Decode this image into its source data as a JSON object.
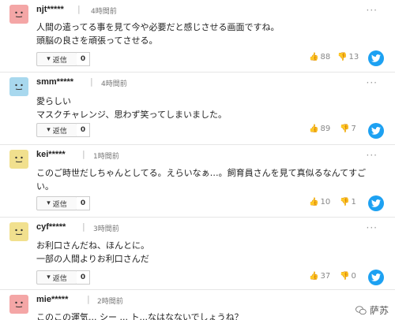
{
  "comments": [
    {
      "user": "njt*****",
      "time": "4時間前",
      "lines": [
        "人間の遣ってる事を見て今や必要だと感じさせる画面ですね。",
        "頭脳の良さを頑張ってさせる。"
      ],
      "reply_label": "返信",
      "reply_count": "0",
      "likes": "88",
      "dislikes": "13",
      "avatar_color": "#f4a6a6"
    },
    {
      "user": "smm*****",
      "time": "4時間前",
      "lines": [
        "愛らしい",
        "マスクチャレンジ、思わず笑ってしまいました。"
      ],
      "reply_label": "返信",
      "reply_count": "0",
      "likes": "89",
      "dislikes": "7",
      "avatar_color": "#a8d8ee"
    },
    {
      "user": "kei*****",
      "time": "1時間前",
      "lines": [
        "このご時世だしちゃんとしてる。えらいなぁ…。飼育員さんを見て真似るなんてすご",
        "い。"
      ],
      "reply_label": "返信",
      "reply_count": "0",
      "likes": "10",
      "dislikes": "1",
      "avatar_color": "#f1e08e"
    },
    {
      "user": "cyf*****",
      "time": "3時間前",
      "lines": [
        "お利口さんだね、ほんとに。",
        "一部の人間よりお利口さんだ"
      ],
      "reply_label": "返信",
      "reply_count": "0",
      "likes": "37",
      "dislikes": "0",
      "avatar_color": "#f1e08e"
    },
    {
      "user": "mie*****",
      "time": "2時間前",
      "lines": [
        "このこの運気... シー ... ト...なはなないでしょうね？"
      ],
      "avatar_color": "#f4a6a6"
    }
  ],
  "menu_glyph": "···",
  "separator": "|",
  "watermark_text": "萨苏",
  "colors": {
    "twitter": "#1da1f2",
    "divider": "#e6e6e6"
  }
}
